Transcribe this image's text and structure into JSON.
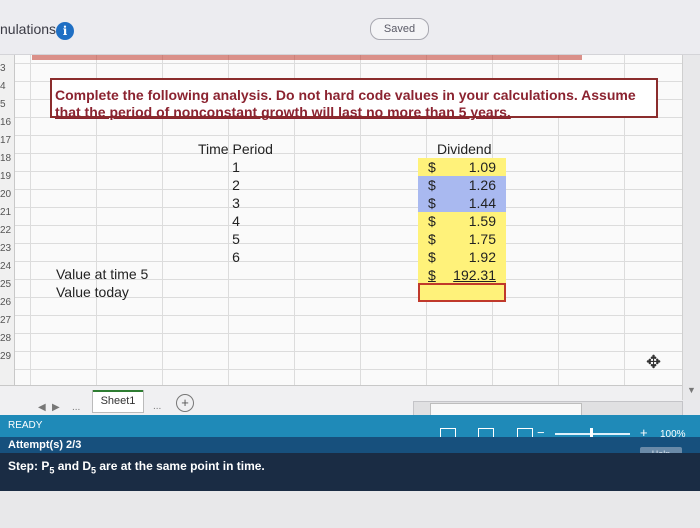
{
  "header": {
    "title": "nulations",
    "info_icon": "i",
    "saved_label": "Saved"
  },
  "sheet": {
    "row_numbers": [
      "3",
      "4",
      "5",
      "16",
      "17",
      "18",
      "19",
      "20",
      "21",
      "22",
      "23",
      "24",
      "25",
      "26",
      "27",
      "28",
      "29"
    ],
    "instruction_line1": "Complete the following analysis. Do not hard code values in your calculations. Assume",
    "instruction_line2": "that the period of nonconstant growth will last no more than 5 years.",
    "col_time_header": "Time Period",
    "col_dividend_header": "Dividend",
    "time_periods": [
      "1",
      "2",
      "3",
      "4",
      "5",
      "6"
    ],
    "dividends": [
      {
        "currency": "$",
        "value": "1.09"
      },
      {
        "currency": "$",
        "value": "1.26"
      },
      {
        "currency": "$",
        "value": "1.44"
      },
      {
        "currency": "$",
        "value": "1.59"
      },
      {
        "currency": "$",
        "value": "1.75"
      },
      {
        "currency": "$",
        "value": "1.92"
      },
      {
        "currency": "$",
        "value": "192.31"
      }
    ],
    "label_value_time5": "Value at time 5",
    "label_value_today": "Value today",
    "colors": {
      "yellow": "#fff27a",
      "blue": "#a9b9f0",
      "red": "#c0392b"
    }
  },
  "tabs": {
    "more": "...",
    "sheet_name": "Sheet1",
    "more2": "...",
    "add_icon": "+"
  },
  "status": {
    "ready": "READY",
    "attempts": "Attempt(s)   2/3",
    "step": "Step: P",
    "step_rest": " and D",
    "step_end": " are at the same point in time.",
    "sub": "5",
    "zoom_minus": "−",
    "zoom_plus": "+",
    "zoom": "100%",
    "zoom_level_percent": 100,
    "help": "Help"
  }
}
